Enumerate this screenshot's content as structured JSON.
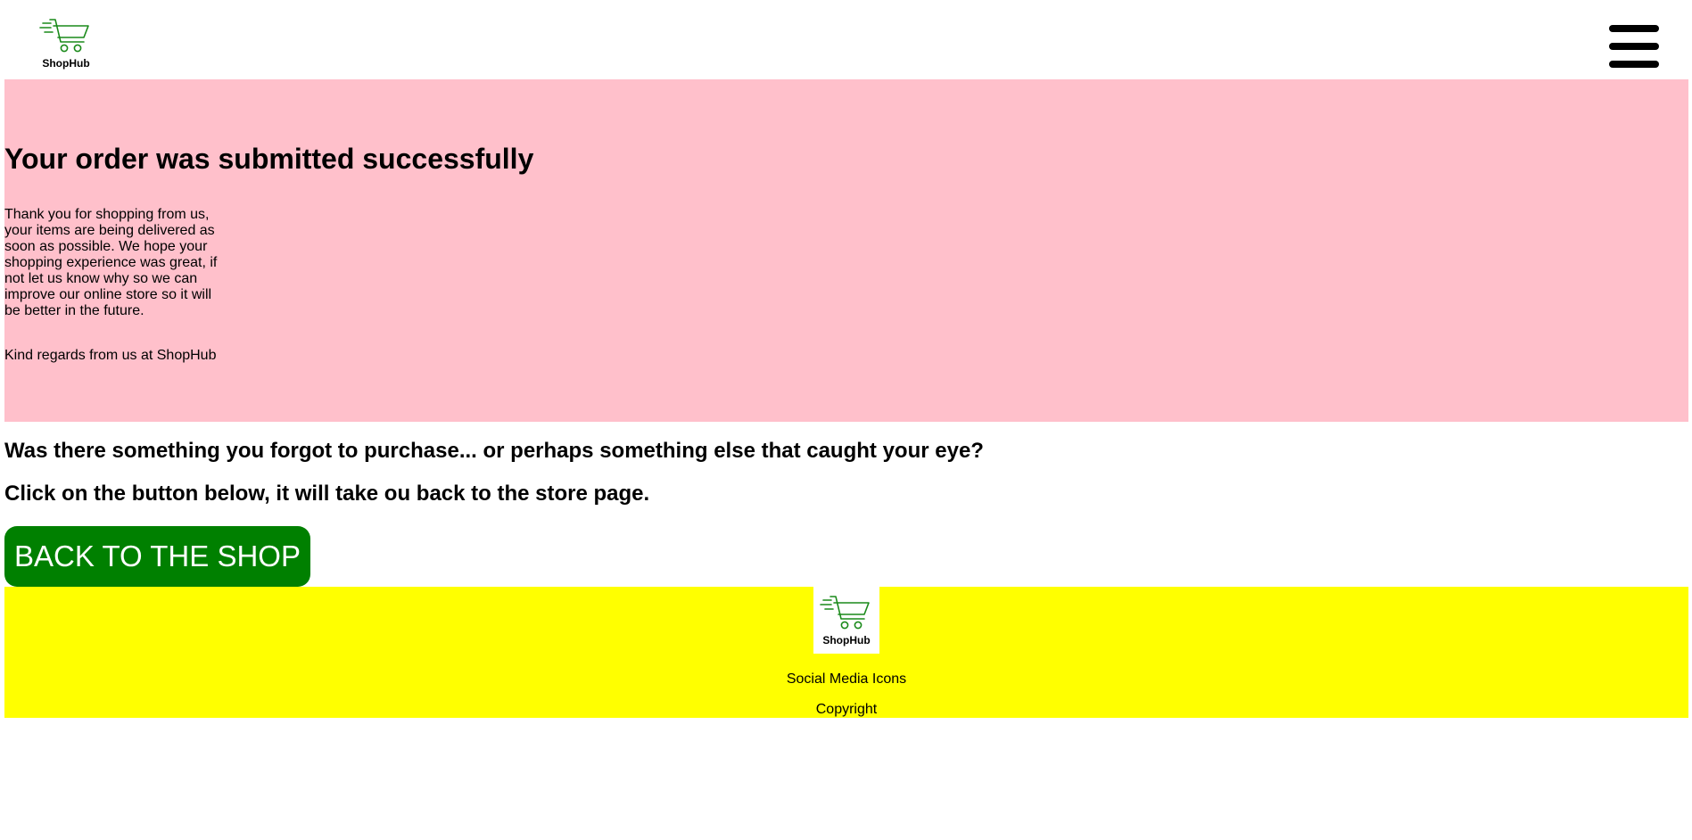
{
  "header": {
    "logo_text": "ShopHub",
    "logo_icon": "shopping-cart-icon",
    "menu_icon": "hamburger-menu-icon"
  },
  "hero": {
    "title": "Your order was submitted successfully",
    "message": "Thank you for shopping from us, your items are being delivered as soon as possible. We hope your shopping experience was great, if not let us know why so we can improve our online store so it will be better in the future.",
    "regards": "Kind regards from us at ShopHub"
  },
  "prompt": {
    "line_1": "Was there something you forgot to purchase... or perhaps something else that caught your eye?",
    "line_2": "Click on the button below, it will take ou back to the store page.",
    "button_label": "BACK TO THE SHOP"
  },
  "footer": {
    "logo_text": "ShopHub",
    "social_text": "Social Media Icons",
    "copyright_text": "Copyright"
  },
  "colors": {
    "hero_background": "#ffc0cb",
    "button_background": "#008000",
    "button_text": "#ffffff",
    "footer_background": "#ffff00",
    "logo_green": "#1a8a1a"
  }
}
